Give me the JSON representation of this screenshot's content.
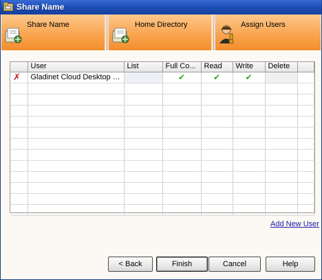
{
  "window": {
    "title": "Share Name"
  },
  "wizard": {
    "steps": [
      {
        "label": "Share Name",
        "icon": "share-folder-icon"
      },
      {
        "label": "Home Directory",
        "icon": "home-directory-icon"
      },
      {
        "label": "Assign Users",
        "icon": "assign-users-icon"
      }
    ]
  },
  "grid": {
    "columns": [
      "",
      "User",
      "List",
      "Full Co...",
      "Read",
      "Write",
      "Delete"
    ],
    "rows": [
      {
        "user": "Gladinet Cloud Desktop In...",
        "list": false,
        "full_control": true,
        "read": true,
        "write": true,
        "delete": false,
        "marker_icon": "delete-x-icon"
      }
    ],
    "check_glyph": "✔",
    "empty_row_count": 12
  },
  "links": {
    "add_new_user": "Add New User"
  },
  "buttons": {
    "back": "< Back",
    "finish": "Finish",
    "cancel": "Cancel",
    "help": "Help"
  },
  "colors": {
    "title_bar": "#1f4fb8",
    "header_orange": "#f9a24a",
    "link": "#1a1aa6",
    "check": "#3aa12a",
    "x_mark": "#c41e1e"
  }
}
